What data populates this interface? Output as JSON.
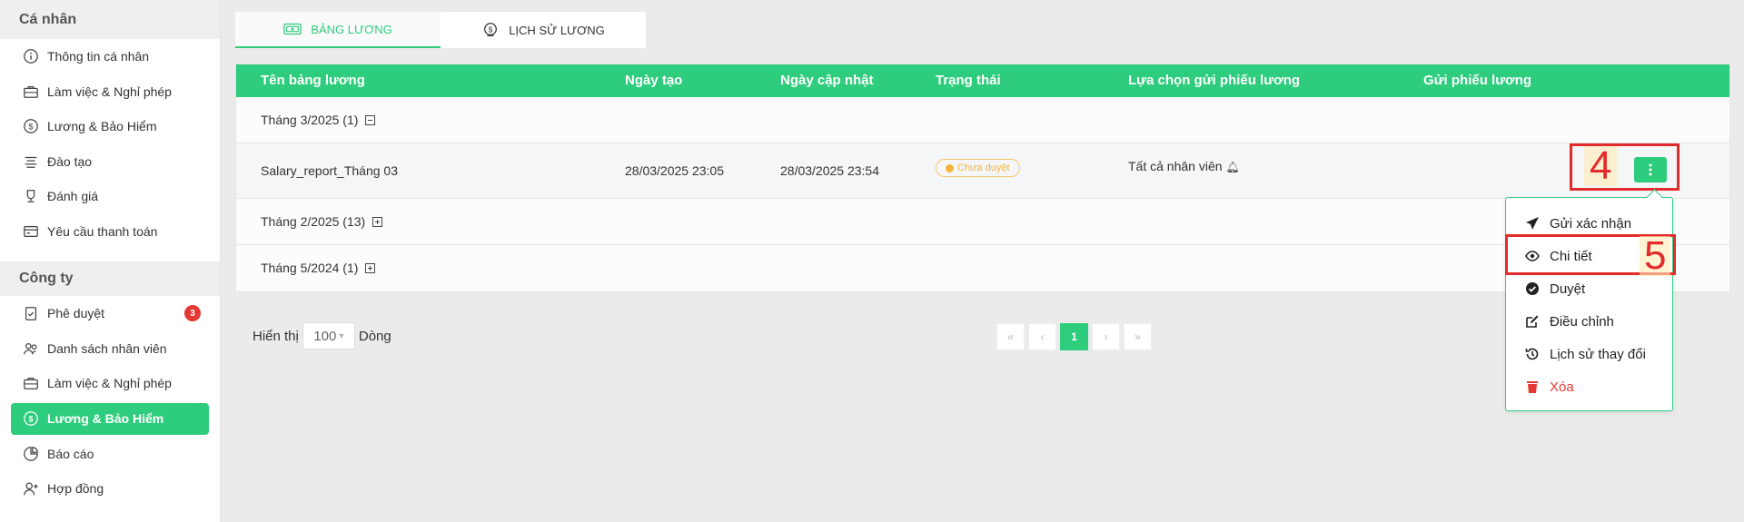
{
  "sidebar": {
    "personal_title": "Cá nhân",
    "personal_items": [
      {
        "label": "Thông tin cá nhân",
        "icon": "info-icon"
      },
      {
        "label": "Làm việc & Nghỉ phép",
        "icon": "briefcase-icon"
      },
      {
        "label": "Lương & Bảo Hiểm",
        "icon": "dollar-circle-icon"
      },
      {
        "label": "Đào tạo",
        "icon": "training-icon"
      },
      {
        "label": "Đánh giá",
        "icon": "evaluation-icon"
      },
      {
        "label": "Yêu cầu thanh toán",
        "icon": "payment-card-icon"
      }
    ],
    "company_title": "Công ty",
    "company_items": [
      {
        "label": "Phê duyệt",
        "icon": "clipboard-check-icon",
        "badge": "3"
      },
      {
        "label": "Danh sách nhân viên",
        "icon": "users-icon"
      },
      {
        "label": "Làm việc & Nghỉ phép",
        "icon": "briefcase-icon"
      },
      {
        "label": "Lương & Bảo Hiểm",
        "icon": "dollar-circle-icon",
        "active": true
      },
      {
        "label": "Báo cáo",
        "icon": "pie-chart-icon"
      },
      {
        "label": "Hợp đồng",
        "icon": "user-plus-icon"
      }
    ]
  },
  "tabs": [
    {
      "label": "BẢNG LƯƠNG",
      "icon": "money-bill-icon",
      "active": true
    },
    {
      "label": "LỊCH SỬ LƯƠNG",
      "icon": "money-bag-icon",
      "active": false
    }
  ],
  "table": {
    "headers": {
      "name": "Tên bảng lương",
      "created": "Ngày tạo",
      "updated": "Ngày cập nhật",
      "status": "Trạng thái",
      "send_option": "Lựa chọn gửi phiếu lương",
      "send": "Gửi phiếu lương"
    },
    "groups": [
      {
        "label": "Tháng 3/2025 (1)",
        "expanded": true
      },
      {
        "label": "Tháng 2/2025 (13)",
        "expanded": false
      },
      {
        "label": "Tháng 5/2024 (1)",
        "expanded": false
      }
    ],
    "row": {
      "name": "Salary_report_Tháng 03",
      "created": "28/03/2025 23:05",
      "updated": "28/03/2025 23:54",
      "status": "Chưa duyệt",
      "send_option": "Tất cả nhân viên"
    }
  },
  "annotations": {
    "more_button": "4",
    "detail_item": "5"
  },
  "menu": [
    {
      "label": "Gửi xác nhận",
      "icon": "send-icon"
    },
    {
      "label": "Chi tiết",
      "icon": "eye-icon"
    },
    {
      "label": "Duyệt",
      "icon": "check-circle-icon"
    },
    {
      "label": "Điều chỉnh",
      "icon": "edit-icon"
    },
    {
      "label": "Lịch sử thay đổi",
      "icon": "history-icon"
    },
    {
      "label": "Xóa",
      "icon": "trash-icon",
      "danger": true
    }
  ],
  "pagination": {
    "show_label": "Hiển thị",
    "page_size": "100",
    "rows_label": "Dòng",
    "first": "«",
    "prev": "‹",
    "current": "1",
    "next": "›",
    "last": "»"
  },
  "colors": {
    "accent": "#2ecc7d",
    "danger": "#e53935",
    "warning": "#f5b43b",
    "highlight": "#e32b2b"
  }
}
